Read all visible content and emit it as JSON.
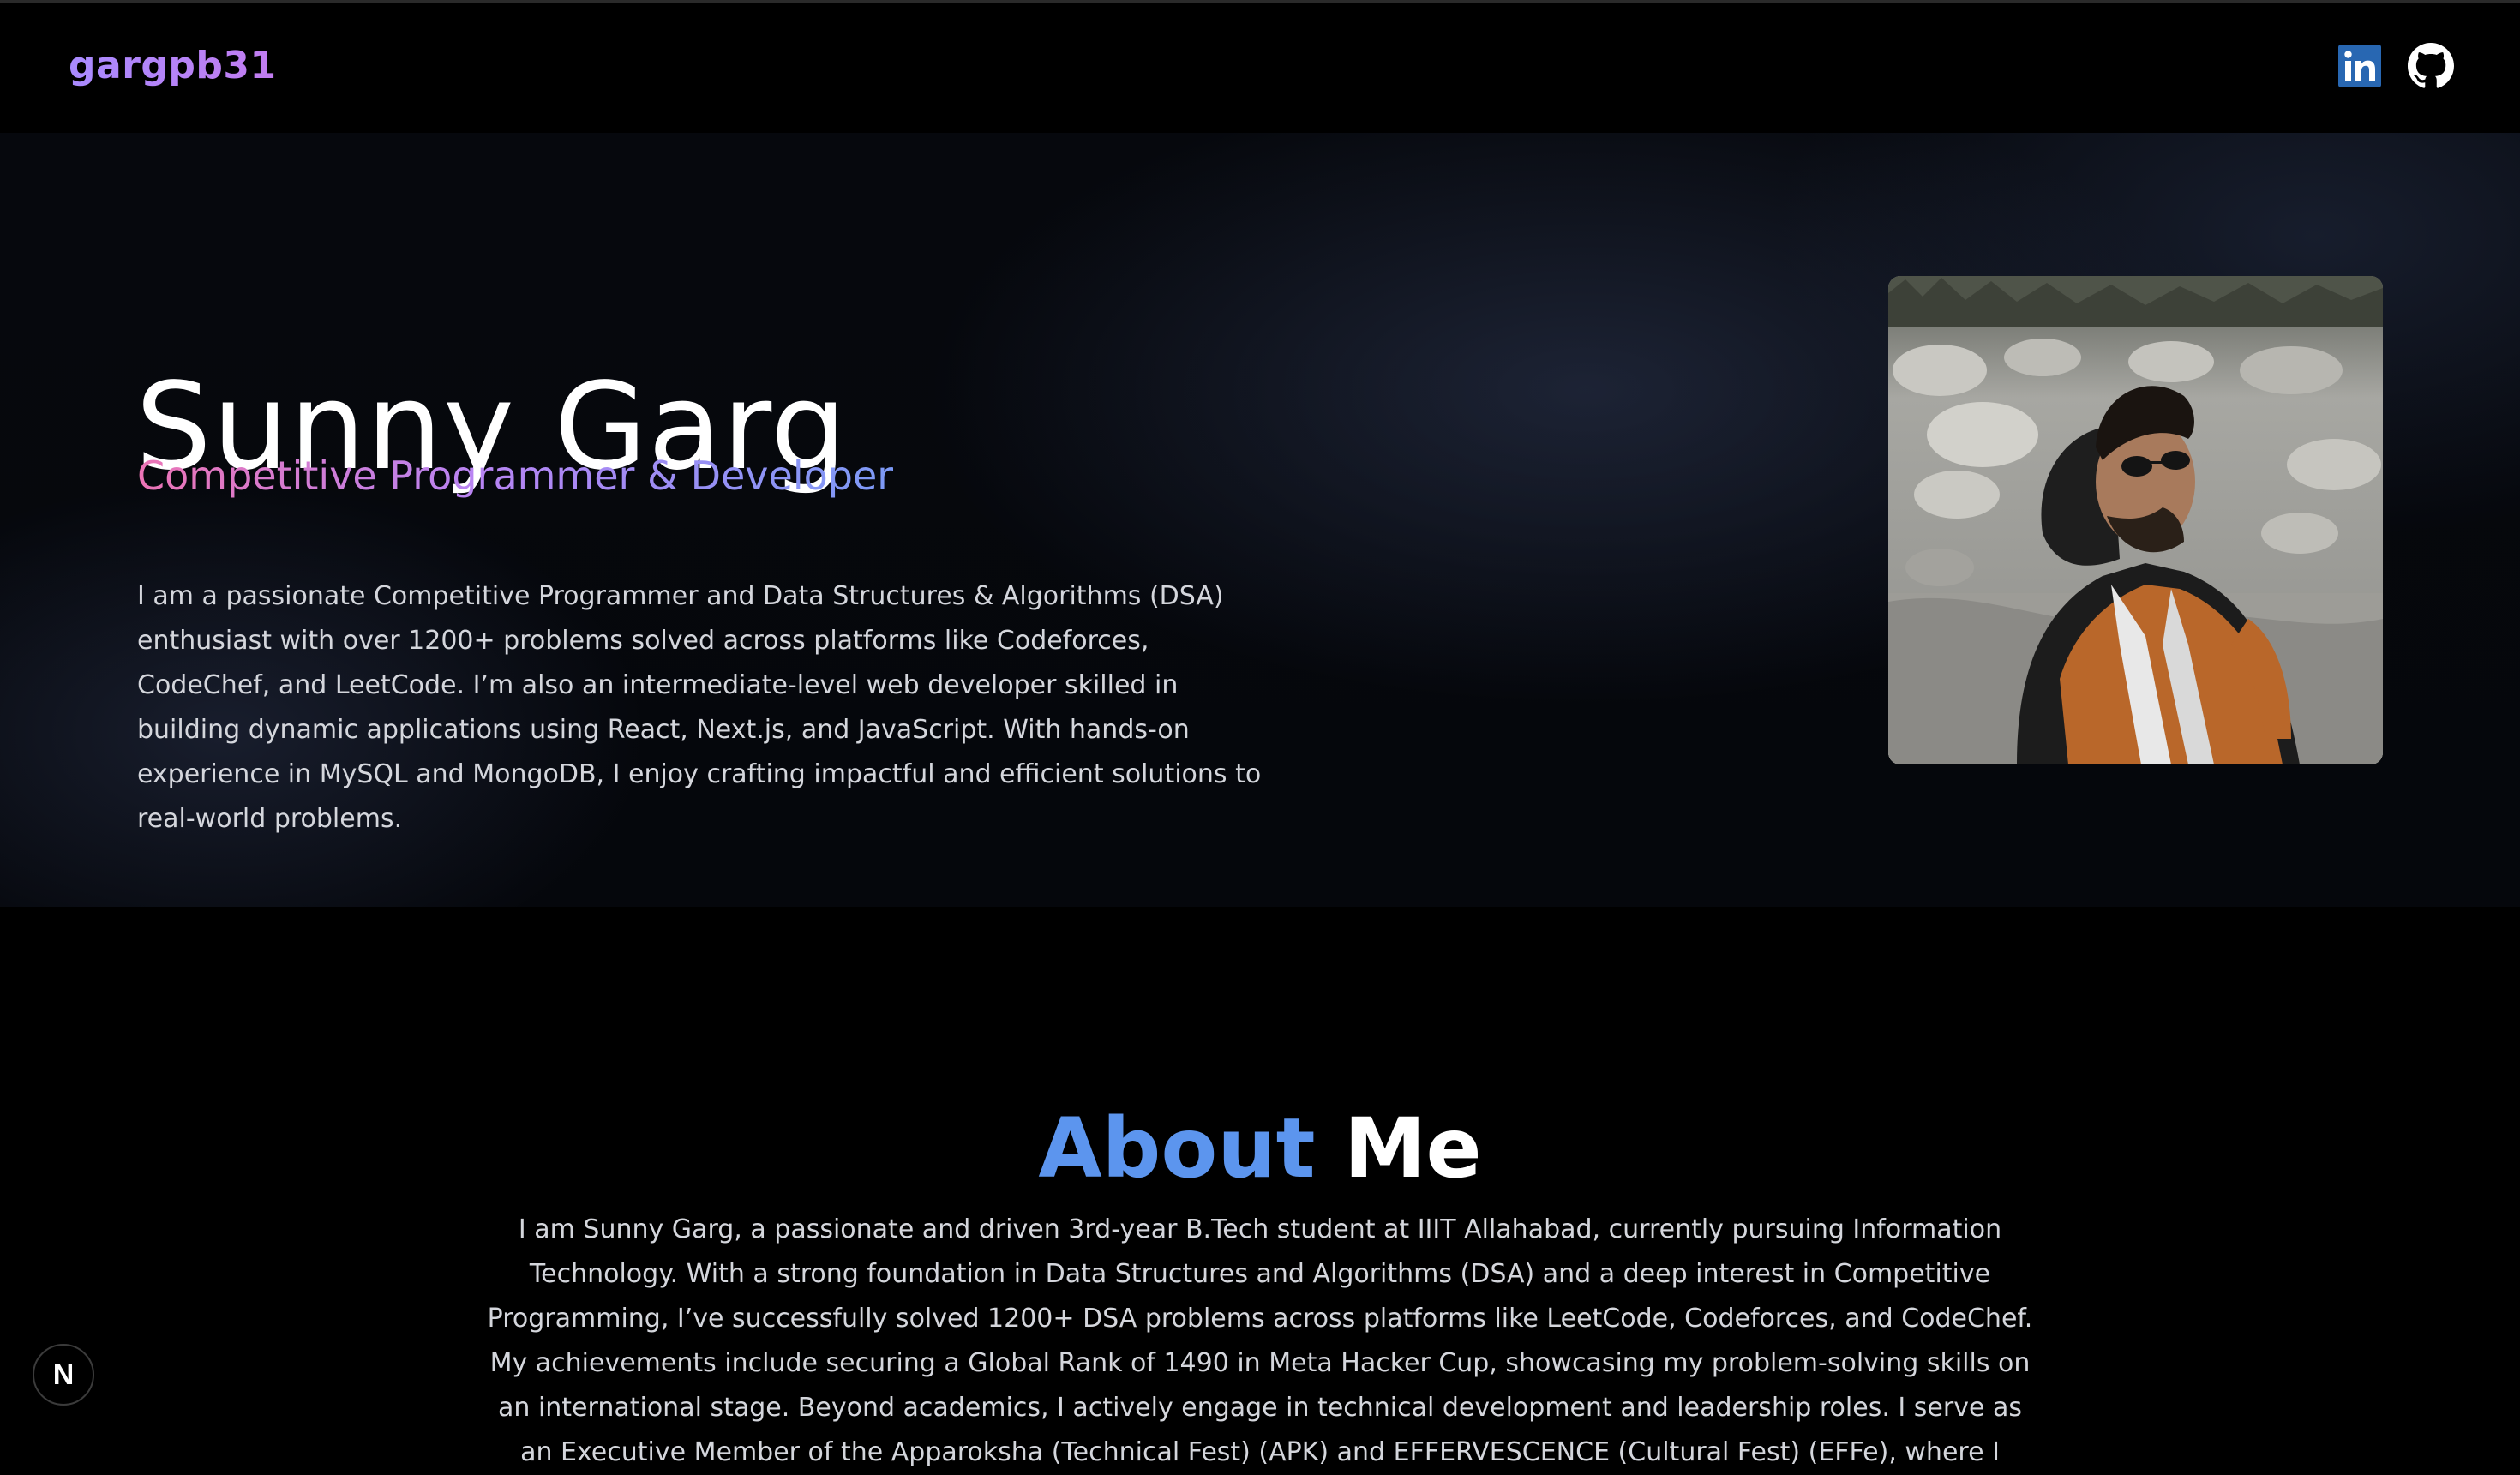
{
  "header": {
    "brand": "gargpb31",
    "social": [
      {
        "name": "LinkedIn",
        "icon": "linkedin-icon"
      },
      {
        "name": "GitHub",
        "icon": "github-icon"
      }
    ]
  },
  "hero": {
    "name": "Sunny Garg",
    "role": "Competitive Programmer & Developer",
    "bio": "I am a passionate Competitive Programmer and Data Structures & Algorithms (DSA) enthusiast with over 1200+ problems solved across platforms like Codeforces, CodeChef, and LeetCode. I’m also an intermediate-level web developer skilled in building dynamic applications using React, Next.js, and JavaScript. With hands-on experience in MySQL and MongoDB, I enjoy crafting impactful and efficient solutions to real-world problems.",
    "photo": {
      "icon": "profile-photo"
    }
  },
  "about": {
    "title_accent": "About",
    "title_rest": "Me",
    "text": "I am Sunny Garg, a passionate and driven 3rd-year B.Tech student at IIIT Allahabad, currently pursuing Information Technology. With a strong foundation in Data Structures and Algorithms (DSA) and a deep interest in Competitive Programming, I’ve successfully solved 1200+ DSA problems across platforms like LeetCode, Codeforces, and CodeChef. My achievements include securing a Global Rank of 1490 in Meta Hacker Cup, showcasing my problem-solving skills on an international stage. Beyond academics, I actively engage in technical development and leadership roles. I serve as an Executive Member of the Apparoksha (Technical Fest) (APK) and EFFERVESCENCE (Cultural Fest) (EFFe), where I"
  },
  "dev_badge": {
    "label": "N",
    "icon": "nextjs-dev-icon"
  },
  "colors": {
    "background": "#000000",
    "about_accent": "#5c95ee",
    "role_gradient": [
      "#ec74b5",
      "#b884f3",
      "#7c9af6"
    ],
    "linkedin": "#2867b2"
  }
}
